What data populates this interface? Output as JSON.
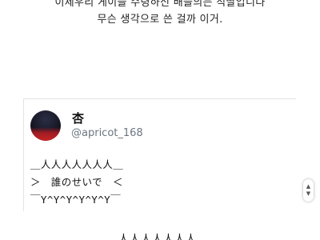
{
  "caption": {
    "line1": "이제우리 게이들 수령하신 배들의는 직딸입니다",
    "line2": "무슨 생각으로 쓴 걸까 이거."
  },
  "tweet": {
    "display_name": "杏",
    "handle": "@apricot_168",
    "ascii_art": [
      "＿人人人人人人人＿",
      "＞　誰のせいで　＜",
      "￣Y^Y^Y^Y^Y^Y￣"
    ]
  },
  "scroll_control": {
    "up_icon": "chevron-up-icon",
    "down_icon": "chevron-down-icon"
  },
  "bottom_partial": "人人人人人人人"
}
